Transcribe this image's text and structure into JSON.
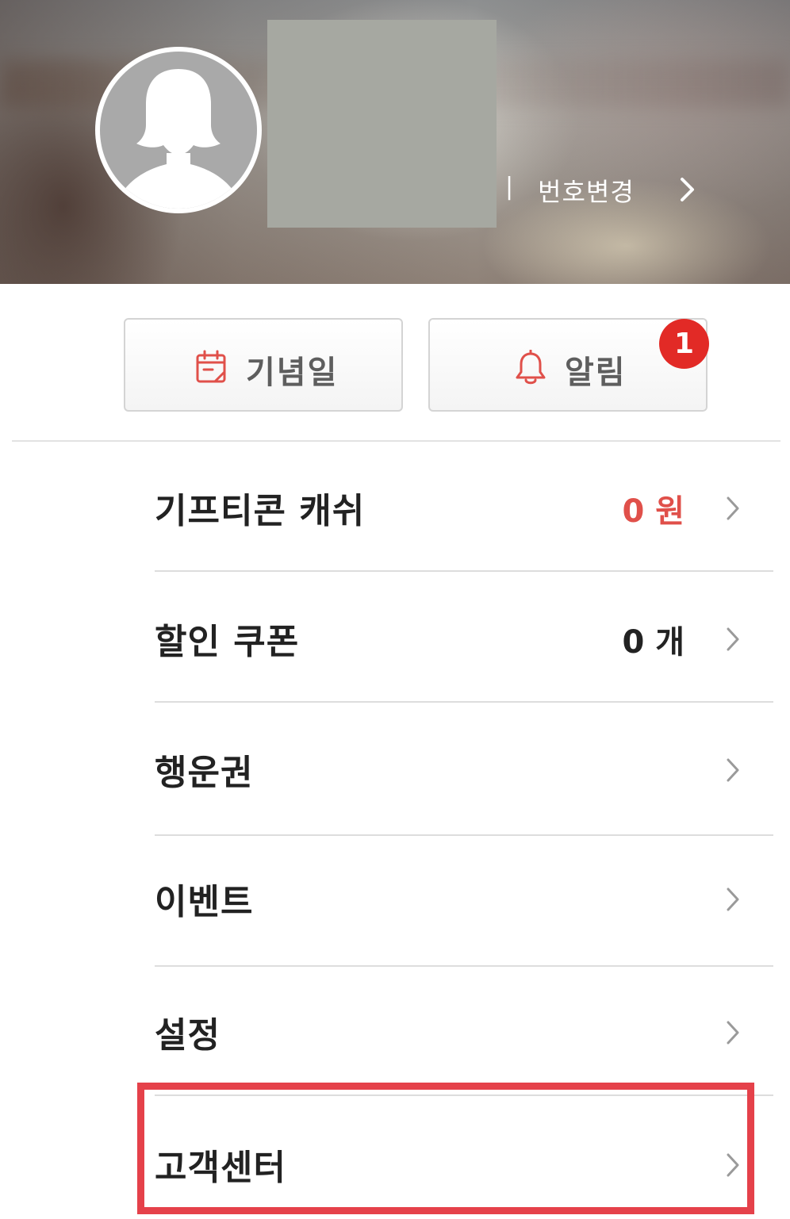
{
  "profile": {
    "phone_separator": "|",
    "change_number_label": "번호변경"
  },
  "quick_actions": {
    "anniversary_label": "기념일",
    "notification_label": "알림",
    "notification_badge": "1"
  },
  "menu": [
    {
      "label": "기프티콘 캐쉬",
      "value": "0 원",
      "value_color": "#e0504a"
    },
    {
      "label": "할인 쿠폰",
      "value": "0 개"
    },
    {
      "label": "행운권"
    },
    {
      "label": "이벤트"
    },
    {
      "label": "설정"
    },
    {
      "label": "고객센터",
      "highlighted": true
    }
  ],
  "colors": {
    "accent_red": "#e22a26",
    "highlight_border": "#e5414a",
    "icon_red": "#e0504a"
  }
}
